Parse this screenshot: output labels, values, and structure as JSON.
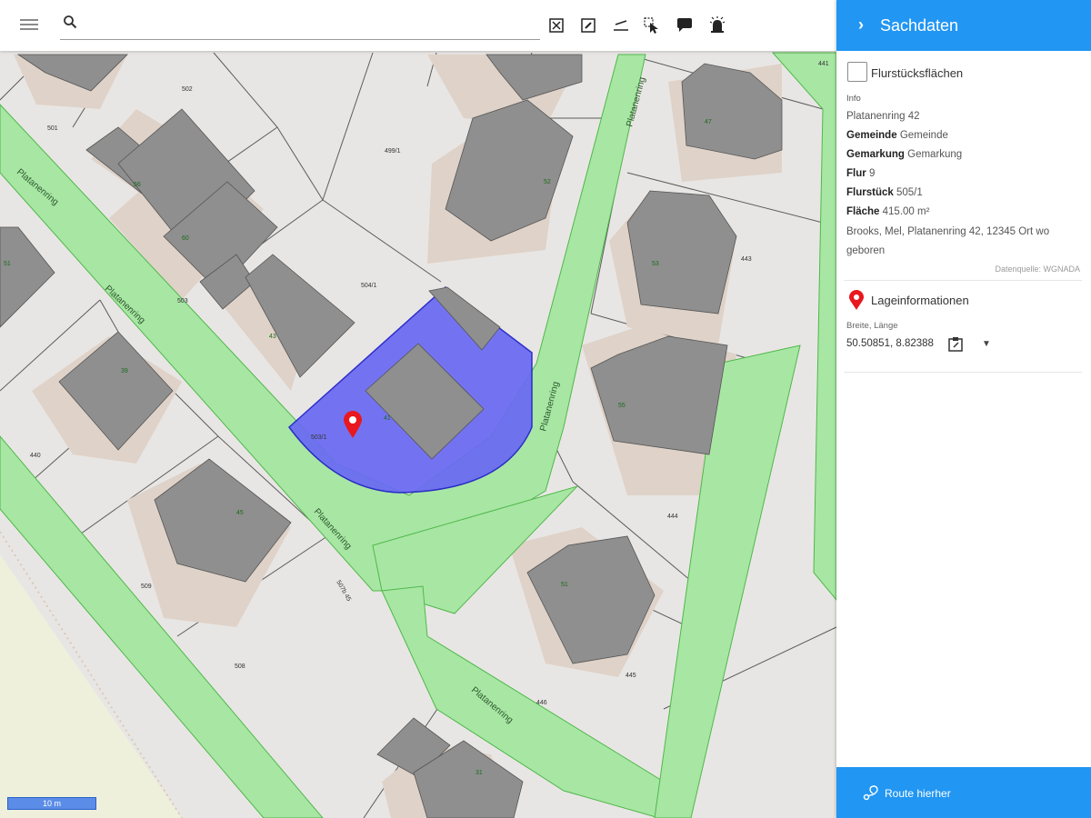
{
  "toolbar": {
    "search_placeholder": "",
    "tools": [
      "fit-extent-icon",
      "edit-icon",
      "measure-icon",
      "select-pointer-icon",
      "comment-icon",
      "alarm-icon"
    ]
  },
  "sidebar": {
    "title": "Sachdaten",
    "checkbox_label": "Flurstücksflächen",
    "info_heading": "Info",
    "address": "Platanenring 42",
    "gemeinde": {
      "label": "Gemeinde",
      "value": "Gemeinde"
    },
    "gemarkung": {
      "label": "Gemarkung",
      "value": "Gemarkung"
    },
    "flur": {
      "label": "Flur",
      "value": "9"
    },
    "flurstueck": {
      "label": "Flurstück",
      "value": "505/1"
    },
    "flaeche": {
      "label": "Fläche",
      "value": "415.00 m²"
    },
    "owner_line1": "Brooks, Mel, Platanenring 42, 12345 Ort wo",
    "owner_line2": "geboren",
    "source": "Datenquelle: WGNADA",
    "lage_label": "Lageinformationen",
    "coord_heading": "Breite, Länge",
    "coords": "50.50851, 8.82388",
    "route_label": "Route hierher"
  },
  "map": {
    "street_labels": [
      "Platanenring",
      "Platanenring",
      "Platanenring",
      "Platanenring",
      "Platanenring",
      "Platanenring",
      "Platanenring"
    ],
    "parcel_labels": [
      "441",
      "502",
      "501",
      "499/1",
      "504/1",
      "503",
      "443",
      "503/1",
      "440",
      "444",
      "509",
      "508",
      "507b 45",
      "445",
      "446"
    ],
    "house_numbers": [
      "47",
      "52",
      "56",
      "60",
      "51",
      "43",
      "39",
      "41",
      "53",
      "45",
      "55",
      "51",
      "31"
    ],
    "scale_label": "10 m"
  },
  "colors": {
    "accent": "#2196f3",
    "street": "#a7e8a2",
    "selection": "#5a5af0",
    "marker": "#e8181e"
  }
}
